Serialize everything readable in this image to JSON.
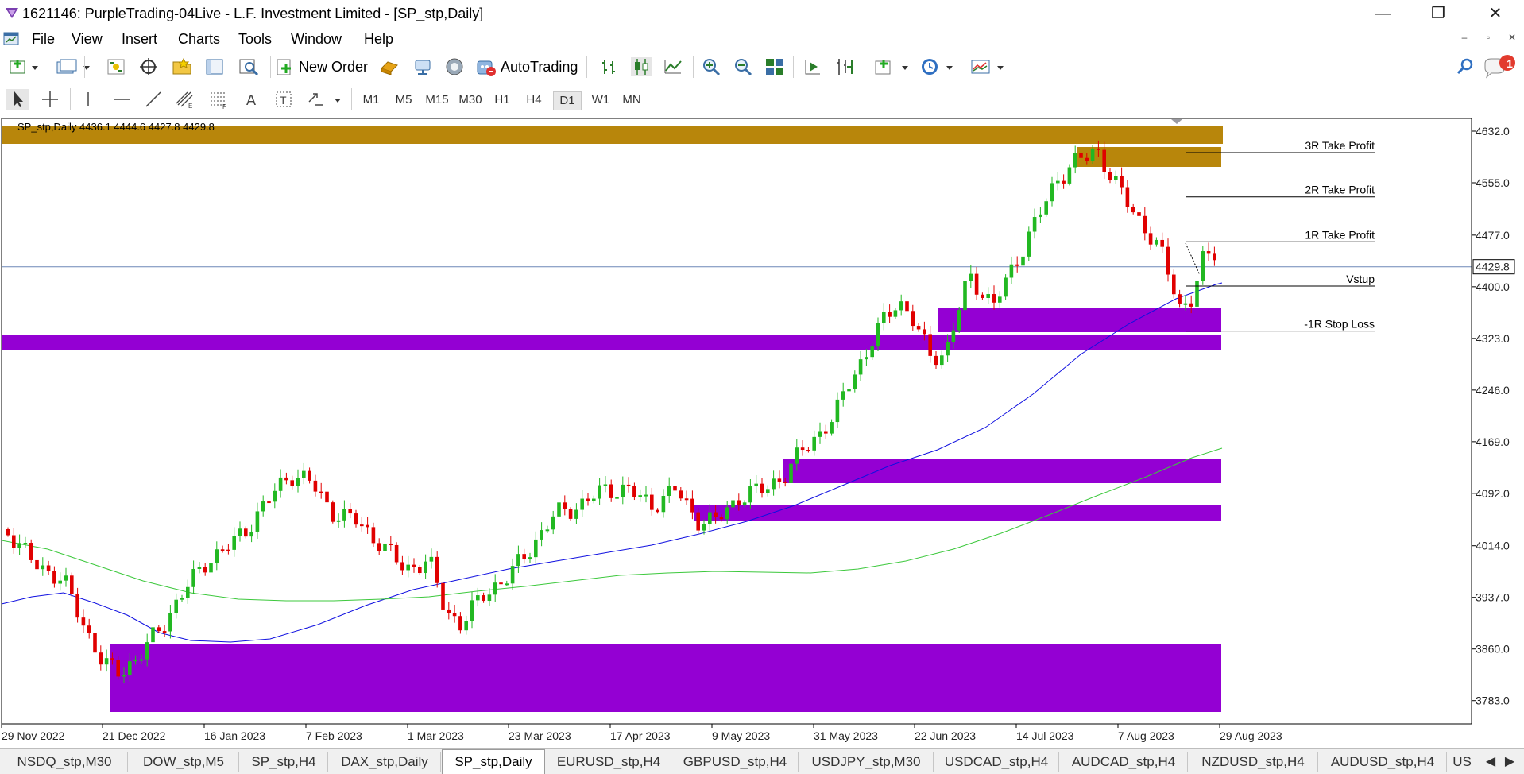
{
  "window": {
    "title": "1621146: PurpleTrading-04Live - L.F. Investment Limited - [SP_stp,Daily]",
    "minimize": "—",
    "restore": "❐",
    "close": "✕"
  },
  "menu": {
    "items": [
      "File",
      "View",
      "Insert",
      "Charts",
      "Tools",
      "Window",
      "Help"
    ],
    "mdi": [
      "–",
      "▫",
      "✕"
    ]
  },
  "toolbar": {
    "new_order_label": "New Order",
    "autotrading_label": "AutoTrading",
    "notification_count": "1"
  },
  "timeframes": {
    "items": [
      "M1",
      "M5",
      "M15",
      "M30",
      "H1",
      "H4",
      "D1",
      "W1",
      "MN"
    ],
    "active": "D1"
  },
  "chart": {
    "header": "SP_stp,Daily  4436.1 4444.6 4427.8 4429.8",
    "current_price": "4429.8",
    "price_levels": [
      "4632.0",
      "4555.0",
      "4477.0",
      "4400.0",
      "4323.0",
      "4246.0",
      "4169.0",
      "4092.0",
      "4014.0",
      "3937.0",
      "3860.0",
      "3783.0"
    ],
    "dates": [
      "29 Nov 2022",
      "21 Dec 2022",
      "16 Jan 2023",
      "7 Feb 2023",
      "1 Mar 2023",
      "23 Mar 2023",
      "17 Apr 2023",
      "9 May 2023",
      "31 May 2023",
      "22 Jun 2023",
      "14 Jul 2023",
      "7 Aug 2023",
      "29 Aug 2023"
    ],
    "trade_levels": [
      {
        "label": "3R Take Profit",
        "price": 4600
      },
      {
        "label": "2R Take Profit",
        "price": 4534
      },
      {
        "label": "1R Take Profit",
        "price": 4467
      },
      {
        "label": "Vstup",
        "price": 4401
      },
      {
        "label": "-1R Stop Loss",
        "price": 4334
      }
    ],
    "colors": {
      "zone_gold": "#b8860b",
      "zone_purple": "#9400d3",
      "bull": "#22b822",
      "bear": "#e00000",
      "ma_blue": "#1010e0",
      "ma_green": "#3cc83c",
      "price_line": "#6d87b7"
    }
  },
  "tabs": {
    "items": [
      "NSDQ_stp,M30",
      "DOW_stp,M5",
      "SP_stp,H4",
      "DAX_stp,Daily",
      "SP_stp,Daily",
      "EURUSD_stp,H4",
      "GBPUSD_stp,H4",
      "USDJPY_stp,M30",
      "USDCAD_stp,H4",
      "AUDCAD_stp,H4",
      "NZDUSD_stp,H4",
      "AUDUSD_stp,H4",
      "US"
    ],
    "active": "SP_stp,Daily",
    "scroll_left": "◀",
    "scroll_right": "▶"
  }
}
